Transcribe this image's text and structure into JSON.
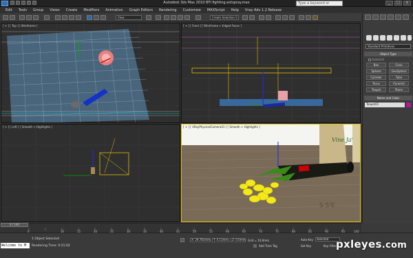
{
  "window": {
    "title": "Autodesk 3ds Max 2010 BFI   fighting.extspray.max",
    "search_placeholder": "Type a keyword or phrase",
    "min": "_",
    "max": "□",
    "close": "x"
  },
  "menubar": {
    "items": [
      "Edit",
      "Tools",
      "Group",
      "Views",
      "Create",
      "Modifiers",
      "Animation",
      "Graph Editors",
      "Rendering",
      "Customize",
      "MAXScript",
      "Help",
      "Vray Adv 1.2 Release"
    ]
  },
  "toolbar": {
    "view_dropdown": "View",
    "selection_set": "Create Selection S"
  },
  "viewports": {
    "top": {
      "label": "[ + ] [ Top ] [ Wireframe ]"
    },
    "front": {
      "label": "[ + ] [ Front ] [ Wireframe + Edged Faces ]"
    },
    "left": {
      "label": "[ + ] [ Left ] [ Smooth + Highlights ]"
    },
    "persp": {
      "label": "[ + ] [ VRayPhysicalCamera01 ] [ Smooth + Highlights ]",
      "bottle_label": "Vine Ja'"
    }
  },
  "command_panel": {
    "dropdown": "Standard Primitives",
    "object_type_header": "Object Type",
    "autogrid": "AutoGrid",
    "buttons": [
      "Box",
      "Cone",
      "Sphere",
      "GeoSphere",
      "Cylinder",
      "Tube",
      "Torus",
      "Pyramid",
      "Teapot",
      "Plane"
    ],
    "name_color_header": "Name and Color",
    "name_value": "Teapot01",
    "swatch_color": "#b0179a"
  },
  "timeline": {
    "slider": "0 / 100",
    "ticks": [
      "0",
      "10",
      "15",
      "20",
      "25",
      "30",
      "35",
      "40",
      "45",
      "50",
      "55",
      "60",
      "65",
      "70",
      "75",
      "80",
      "85",
      "90",
      "95",
      "100"
    ]
  },
  "status": {
    "listener": "Welcome to M",
    "object_selected": "1 Object Selected",
    "rendering_time": "Rendering Time: 0:21:02",
    "x": "X: 29.781mm",
    "y": "Y: 4.11mm",
    "z": "Z: 0.0mm",
    "grid": "Grid = 10.0mm",
    "add_time_tag": "Add Time Tag",
    "auto_key": "Auto Key",
    "set_key": "Set Key",
    "selected": "Selected",
    "key_filters": "Key Filters..."
  },
  "watermark": {
    "text": "pxleyes",
    "suffix": ".com"
  }
}
